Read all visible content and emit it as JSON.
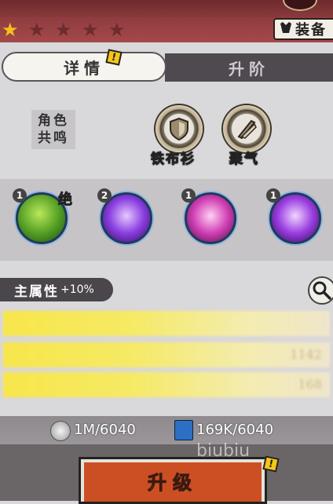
{
  "header": {
    "stars_total": 5,
    "stars_filled": 1,
    "equip_button": "装备"
  },
  "tabs": {
    "details": "详情",
    "advance": "升阶"
  },
  "resonance": {
    "line1": "角色",
    "line2": "共鸣"
  },
  "badges": [
    {
      "label": "铁布衫",
      "icon": "shield-icon"
    },
    {
      "label": "聚气",
      "icon": "qi-blade-icon"
    }
  ],
  "skills": [
    {
      "level": "1",
      "tag": "绝",
      "color": "#5fae2e"
    },
    {
      "level": "2",
      "tag": "",
      "color": "#7a33c9"
    },
    {
      "level": "1",
      "tag": "",
      "color": "#c02fa8"
    },
    {
      "level": "1",
      "tag": "",
      "color": "#8a2ac9"
    }
  ],
  "attributes": {
    "label": "主属性",
    "bonus": "+10%",
    "values": [
      "",
      "1142",
      "168"
    ]
  },
  "resources": {
    "coins": "1M/6040",
    "books": "169K/6040"
  },
  "upgrade_button": "升级",
  "watermark": "biubiu",
  "colors": {
    "accent_red": "#cb4f23",
    "star_gold": "#f2c21b",
    "attr_yellow": "#f7e64a"
  }
}
